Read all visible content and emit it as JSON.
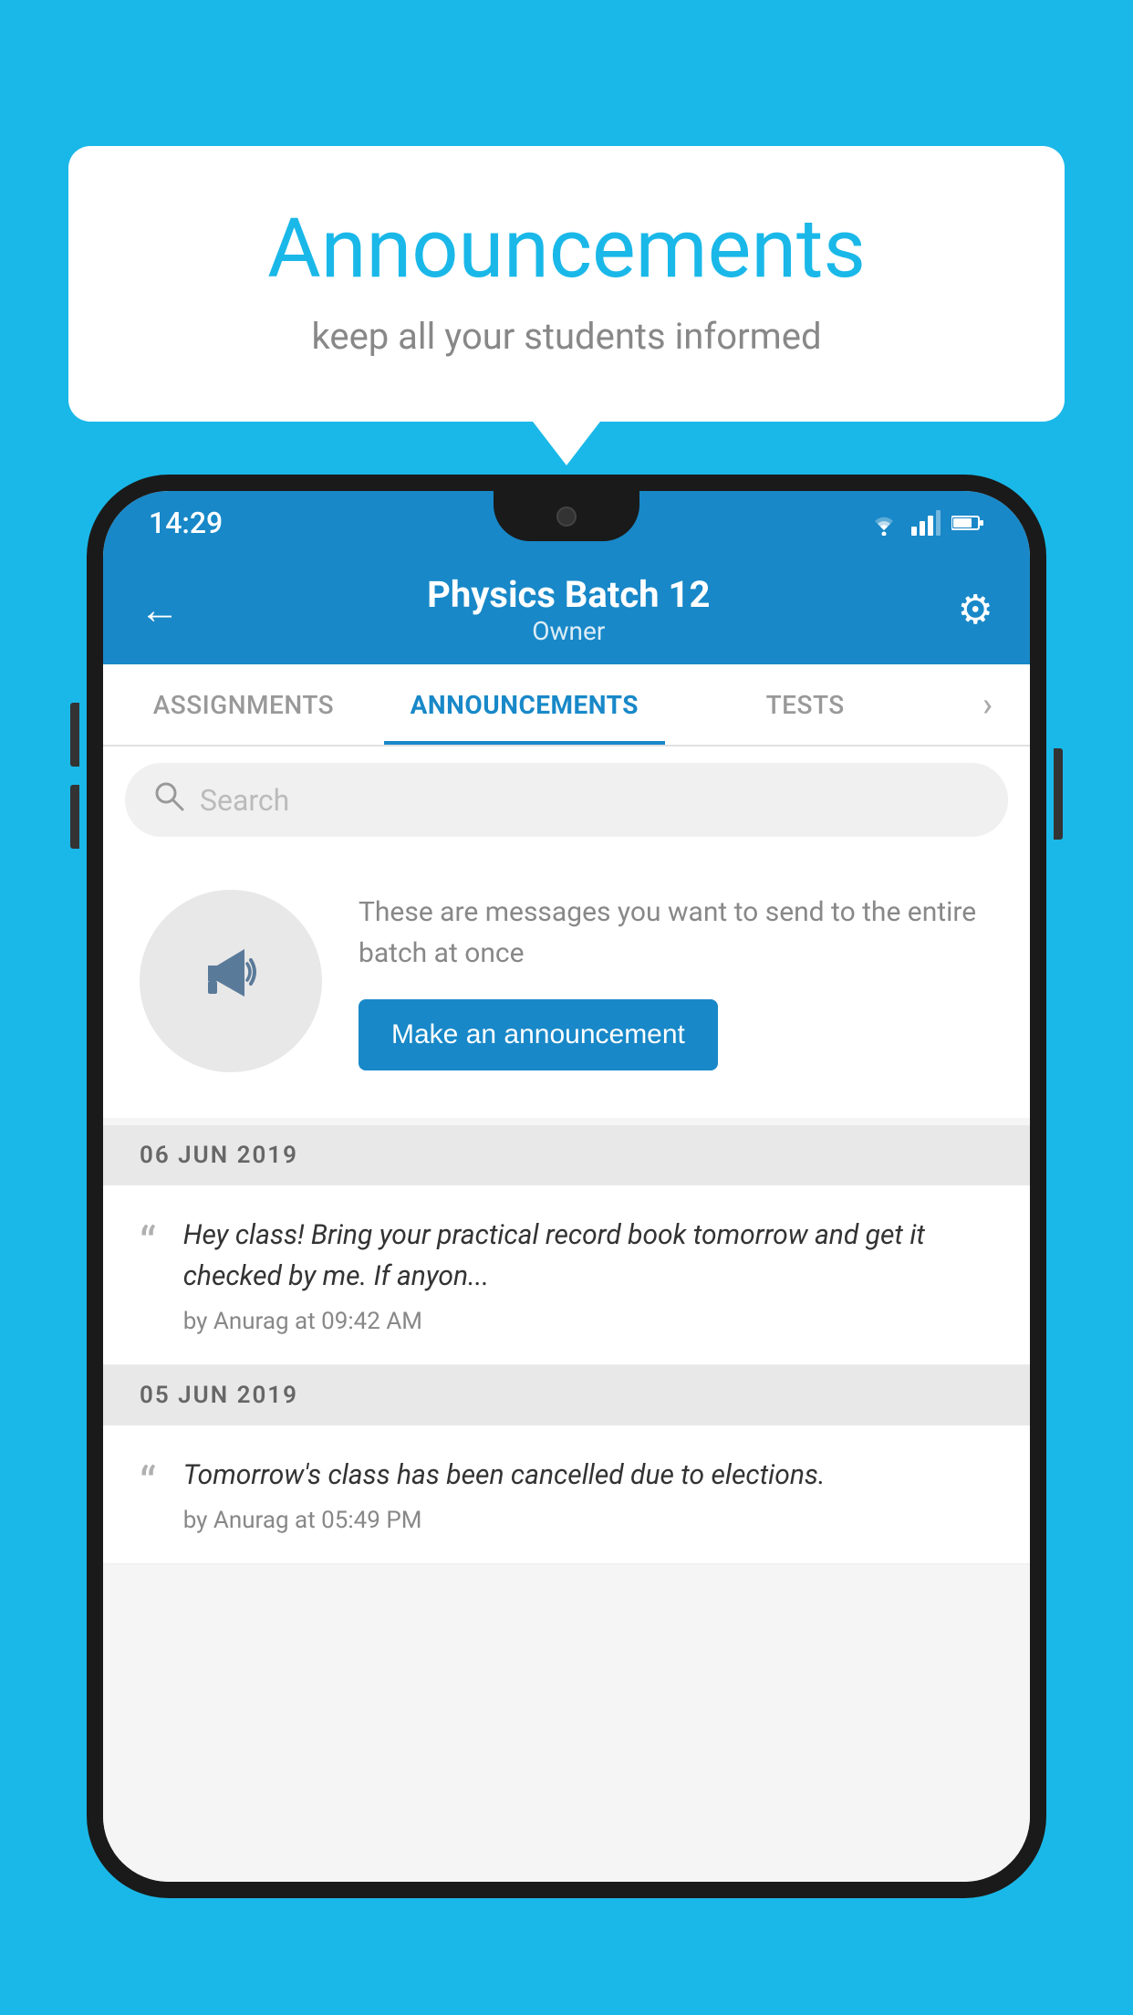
{
  "background_color": "#1ab8e8",
  "hero": {
    "title": "Announcements",
    "subtitle": "keep all your students informed"
  },
  "phone": {
    "status_bar": {
      "time": "14:29",
      "icons": [
        "wifi",
        "signal",
        "battery"
      ]
    },
    "header": {
      "title": "Physics Batch 12",
      "subtitle": "Owner",
      "back_label": "←",
      "gear_label": "⚙"
    },
    "tabs": [
      {
        "label": "ASSIGNMENTS",
        "active": false
      },
      {
        "label": "ANNOUNCEMENTS",
        "active": true
      },
      {
        "label": "TESTS",
        "active": false
      },
      {
        "label": "›",
        "active": false
      }
    ],
    "search": {
      "placeholder": "Search"
    },
    "announcement_prompt": {
      "description": "These are messages you want to\nsend to the entire batch at once",
      "button_label": "Make an announcement"
    },
    "announcements": [
      {
        "date": "06  JUN  2019",
        "message": "Hey class! Bring your practical record book tomorrow and get it checked by me. If anyon...",
        "meta": "by Anurag at 09:42 AM"
      },
      {
        "date": "05  JUN  2019",
        "message": "Tomorrow's class has been cancelled due to elections.",
        "meta": "by Anurag at 05:49 PM"
      }
    ]
  }
}
